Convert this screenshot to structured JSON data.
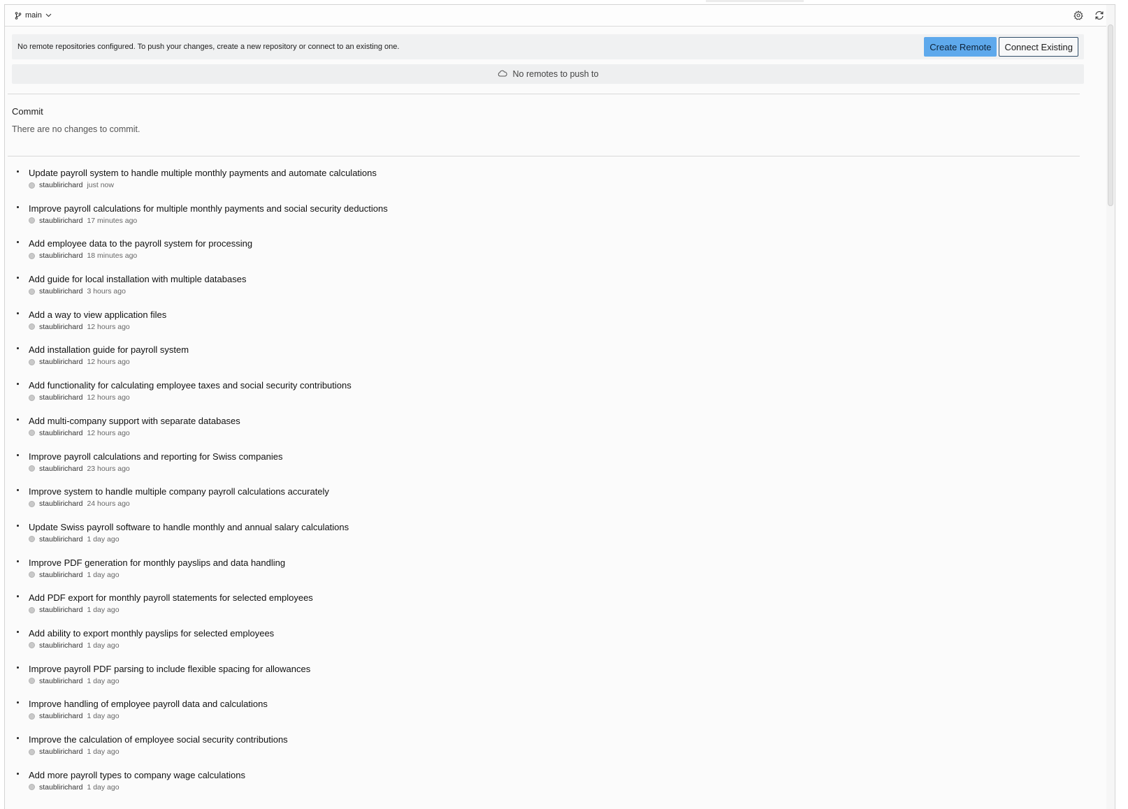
{
  "branch": {
    "name": "main"
  },
  "toolbar": {
    "settings_icon": "gear-icon",
    "refresh_icon": "refresh-icon"
  },
  "notice": {
    "message": "No remote repositories configured. To push your changes, create a new repository or connect to an existing one.",
    "create_label": "Create Remote",
    "connect_label": "Connect Existing"
  },
  "remotes": {
    "empty_label": "No remotes to push to",
    "icon": "cloud-icon"
  },
  "commit": {
    "title": "Commit",
    "empty_message": "There are no changes to commit."
  },
  "history": [
    {
      "message": "Update payroll system to handle multiple monthly payments and automate calculations",
      "author": "staublirichard",
      "time": "just now"
    },
    {
      "message": "Improve payroll calculations for multiple monthly payments and social security deductions",
      "author": "staublirichard",
      "time": "17 minutes ago"
    },
    {
      "message": "Add employee data to the payroll system for processing",
      "author": "staublirichard",
      "time": "18 minutes ago"
    },
    {
      "message": "Add guide for local installation with multiple databases",
      "author": "staublirichard",
      "time": "3 hours ago"
    },
    {
      "message": "Add a way to view application files",
      "author": "staublirichard",
      "time": "12 hours ago"
    },
    {
      "message": "Add installation guide for payroll system",
      "author": "staublirichard",
      "time": "12 hours ago"
    },
    {
      "message": "Add functionality for calculating employee taxes and social security contributions",
      "author": "staublirichard",
      "time": "12 hours ago"
    },
    {
      "message": "Add multi-company support with separate databases",
      "author": "staublirichard",
      "time": "12 hours ago"
    },
    {
      "message": "Improve payroll calculations and reporting for Swiss companies",
      "author": "staublirichard",
      "time": "23 hours ago"
    },
    {
      "message": "Improve system to handle multiple company payroll calculations accurately",
      "author": "staublirichard",
      "time": "24 hours ago"
    },
    {
      "message": "Update Swiss payroll software to handle monthly and annual salary calculations",
      "author": "staublirichard",
      "time": "1 day ago"
    },
    {
      "message": "Improve PDF generation for monthly payslips and data handling",
      "author": "staublirichard",
      "time": "1 day ago"
    },
    {
      "message": "Add PDF export for monthly payroll statements for selected employees",
      "author": "staublirichard",
      "time": "1 day ago"
    },
    {
      "message": "Add ability to export monthly payslips for selected employees",
      "author": "staublirichard",
      "time": "1 day ago"
    },
    {
      "message": "Improve payroll PDF parsing to include flexible spacing for allowances",
      "author": "staublirichard",
      "time": "1 day ago"
    },
    {
      "message": "Improve handling of employee payroll data and calculations",
      "author": "staublirichard",
      "time": "1 day ago"
    },
    {
      "message": "Improve the calculation of employee social security contributions",
      "author": "staublirichard",
      "time": "1 day ago"
    },
    {
      "message": "Add more payroll types to company wage calculations",
      "author": "staublirichard",
      "time": "1 day ago"
    }
  ]
}
